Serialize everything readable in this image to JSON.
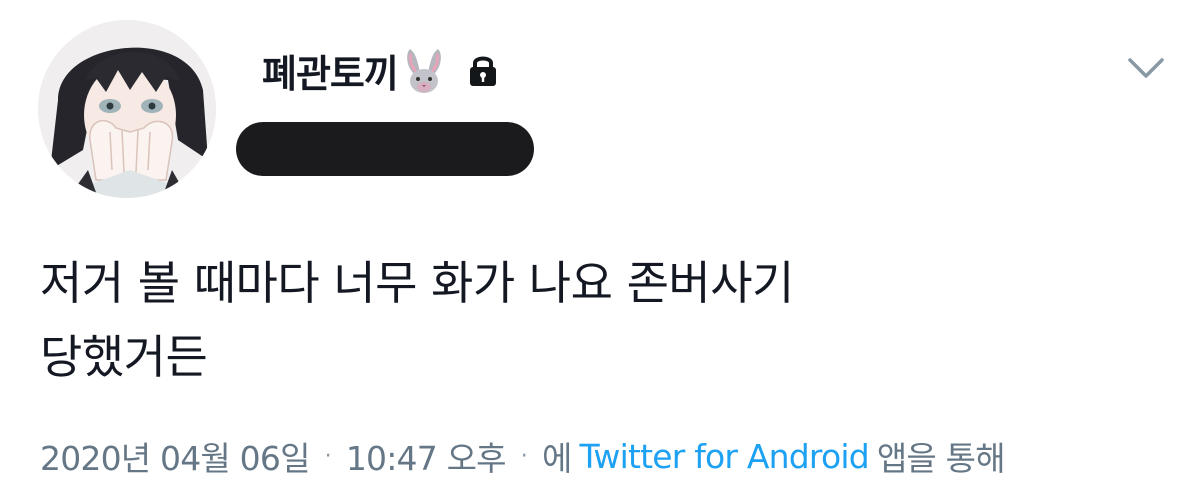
{
  "user": {
    "display_name": "폐관토끼",
    "avatar_icon": "avatar-image",
    "name_emoji_icon": "rabbit-face-icon",
    "protected_icon": "lock-icon",
    "handle_redacted": true
  },
  "actions": {
    "menu_icon": "chevron-down-icon"
  },
  "tweet": {
    "text_line_1": "저거 볼 때마다 너무 화가 나요 존버사기",
    "text_line_2": "당했거든"
  },
  "meta": {
    "date": "2020년 04월 06일",
    "time": "10:47 오후",
    "separator": "·",
    "via_prefix": "에",
    "source": "Twitter for Android",
    "via_suffix": "앱을 통해"
  },
  "colors": {
    "text": "#141823",
    "meta_gray": "#657786",
    "link_blue": "#1da1f2",
    "redaction": "#1b1b1e"
  }
}
